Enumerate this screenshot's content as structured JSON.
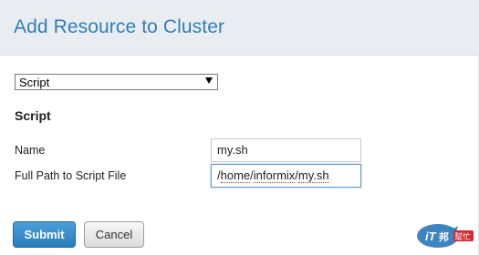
{
  "dialog": {
    "title": "Add Resource to Cluster"
  },
  "resource_type": {
    "selected": "Script"
  },
  "section": {
    "heading": "Script"
  },
  "fields": {
    "name_label": "Name",
    "name_value": "my.sh",
    "path_label": "Full Path to Script File",
    "path_parts": [
      "/",
      "home",
      "/",
      "informix",
      "/",
      "my.sh"
    ]
  },
  "buttons": {
    "submit_label": "Submit",
    "cancel_label": "Cancel"
  },
  "watermark": {
    "brand_text": "iT邦幫忙",
    "colors": {
      "blue": "#1c6fb5",
      "red": "#d6262f"
    }
  },
  "colors": {
    "accent": "#2f7fb6",
    "header_bg": "#e9edf1",
    "focus_border": "#5c9bd1"
  }
}
